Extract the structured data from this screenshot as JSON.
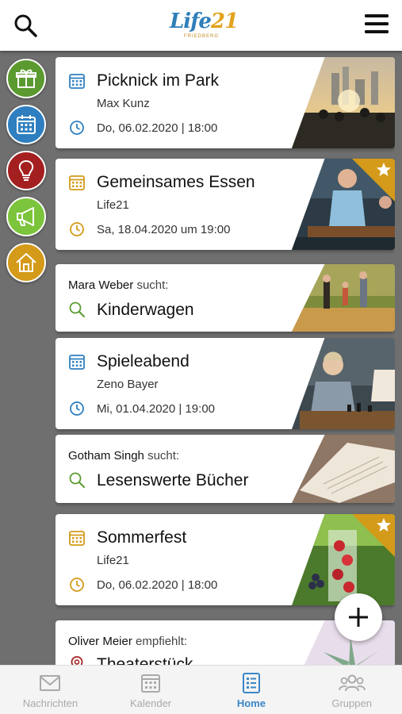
{
  "header": {
    "logo_text_main": "Life",
    "logo_text_num": "21",
    "logo_sub": "FRIEDBERG"
  },
  "sidebar": [
    {
      "name": "gift",
      "color": "#5a9a2f"
    },
    {
      "name": "calendar",
      "color": "#2f7fc0"
    },
    {
      "name": "lightbulb",
      "color": "#a41f1f"
    },
    {
      "name": "megaphone",
      "color": "#7cc43b"
    },
    {
      "name": "home",
      "color": "#d49a19"
    }
  ],
  "cards": [
    {
      "type": "event",
      "title": "Picknick im Park",
      "organizer": "Max Kunz",
      "date": "Do, 06.02.2020 | 18:00",
      "accent": "#2f7fc0",
      "featured": false
    },
    {
      "type": "event",
      "title": "Gemeinsames Essen",
      "organizer": "Life21",
      "date": "Sa, 18.04.2020 um 19:00",
      "accent": "#d49a19",
      "featured": true
    },
    {
      "type": "search",
      "person": "Mara Weber",
      "verb": "sucht:",
      "title": "Kinderwagen",
      "accent": "#5a9a2f"
    },
    {
      "type": "event",
      "title": "Spieleabend",
      "organizer": "Zeno Bayer",
      "date": "Mi, 01.04.2020 | 19:00",
      "accent": "#2f7fc0",
      "featured": false
    },
    {
      "type": "search",
      "person": "Gotham Singh",
      "verb": "sucht:",
      "title": "Lesenswerte Bücher",
      "accent": "#5a9a2f"
    },
    {
      "type": "event",
      "title": "Sommerfest",
      "organizer": "Life21",
      "date": "Do, 06.02.2020 | 18:00",
      "accent": "#d49a19",
      "featured": true
    },
    {
      "type": "recommend",
      "person": "Oliver Meier",
      "verb": "empfiehlt:",
      "title": "Theaterstück",
      "accent": "#a41f1f"
    }
  ],
  "bottom_nav": [
    {
      "label": "Nachrichten",
      "icon": "mail-icon",
      "active": false
    },
    {
      "label": "Kalender",
      "icon": "calendar-icon",
      "active": false
    },
    {
      "label": "Home",
      "icon": "list-icon",
      "active": true
    },
    {
      "label": "Gruppen",
      "icon": "group-icon",
      "active": false
    }
  ],
  "colors": {
    "primary": "#3a86c8",
    "accent_gold": "#d49a19",
    "background": "#6f6f6f"
  }
}
